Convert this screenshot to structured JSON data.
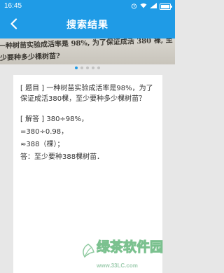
{
  "status_bar": {
    "time": "16:45",
    "battery_level": 0.85
  },
  "header": {
    "title": "搜索结果",
    "back_icon": "chevron-left-icon"
  },
  "photo": {
    "line1": "一种树苗实验成活率是 98%, 为了保证成活 380 裸, 至",
    "line2": "少要种多少棵树苗?"
  },
  "pagination": {
    "count": 5,
    "active_index": 0
  },
  "result": {
    "question": "[ 题目 ] 一种树苗实验成活率是98%，为了保证成活380棵，至少要种多少棵树苗？",
    "solution": [
      "[ 解答 ] 380÷98%，",
      "=380÷0.98，",
      "≈388（棵）；",
      "答：至少要种388棵树苗．"
    ]
  },
  "watermark": {
    "name": "绿茶软件园",
    "url": "www.33LC.com"
  },
  "colors": {
    "primary": "#1f9be6",
    "background": "#e7e7e7",
    "card": "#ffffff",
    "text": "#333333",
    "watermark": "#7bc18f"
  }
}
